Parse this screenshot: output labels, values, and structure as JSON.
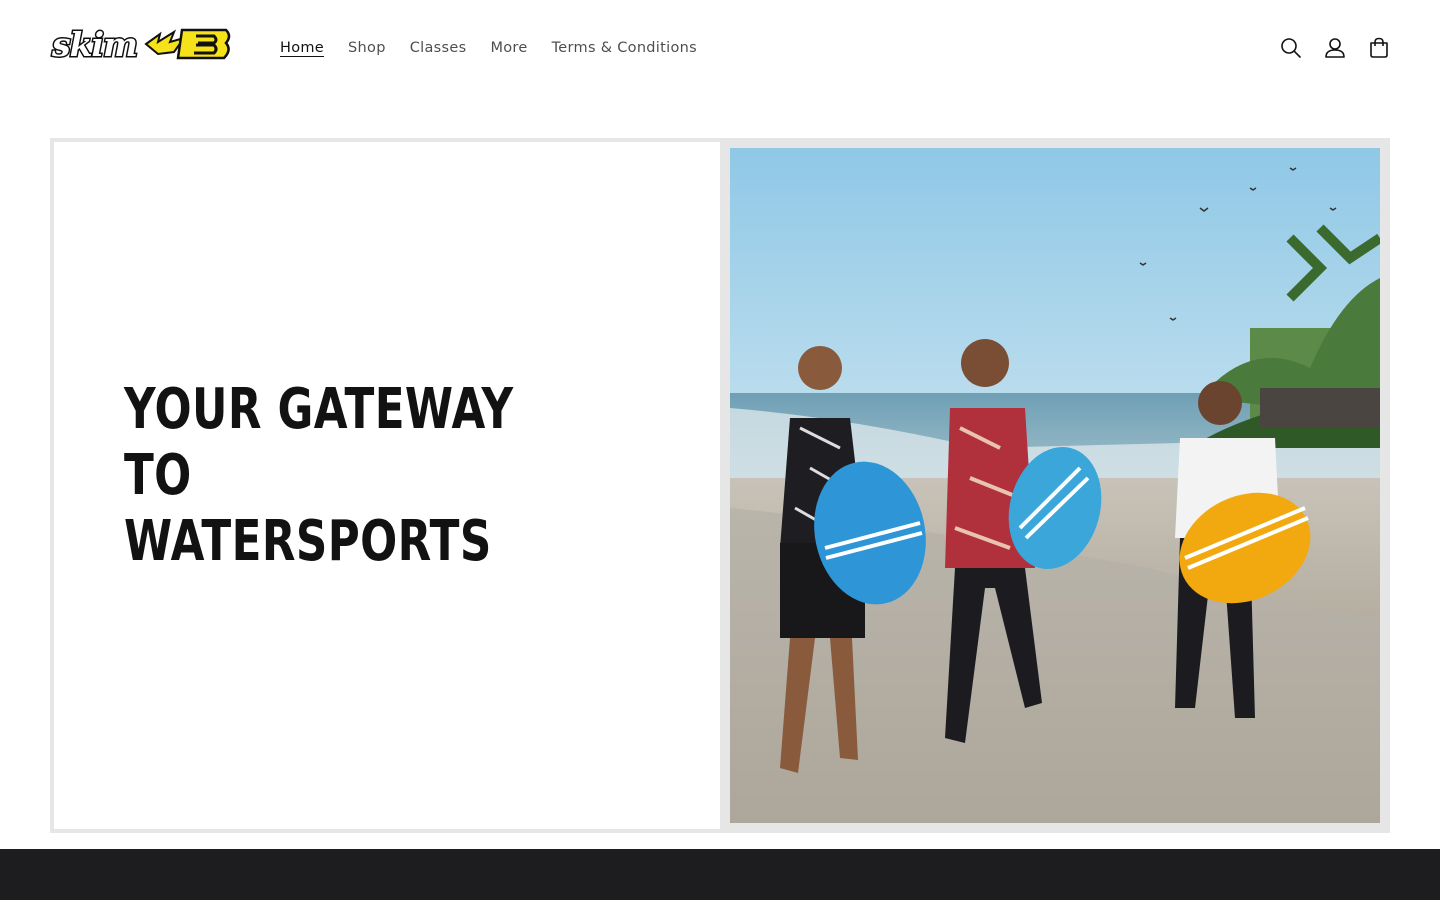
{
  "header": {
    "logo_text": "skim B",
    "nav": [
      {
        "label": "Home",
        "active": true
      },
      {
        "label": "Shop",
        "active": false
      },
      {
        "label": "Classes",
        "active": false
      },
      {
        "label": "More",
        "active": false
      },
      {
        "label": "Terms & Conditions",
        "active": false
      }
    ],
    "icons": [
      "search-icon",
      "account-icon",
      "cart-icon"
    ]
  },
  "banner": {
    "heading": "YOUR GATEWAY TO\nWATERSPORTS",
    "image_alt": "Three people walking on a beach carrying skimboards"
  },
  "colors": {
    "text": "#121212",
    "banner_frame": "#e6e6e6",
    "footer": "#1d1c1e",
    "logo_yellow": "#f5e21a",
    "board_blue": "#2e96d6",
    "board_orange": "#f1a90f"
  }
}
